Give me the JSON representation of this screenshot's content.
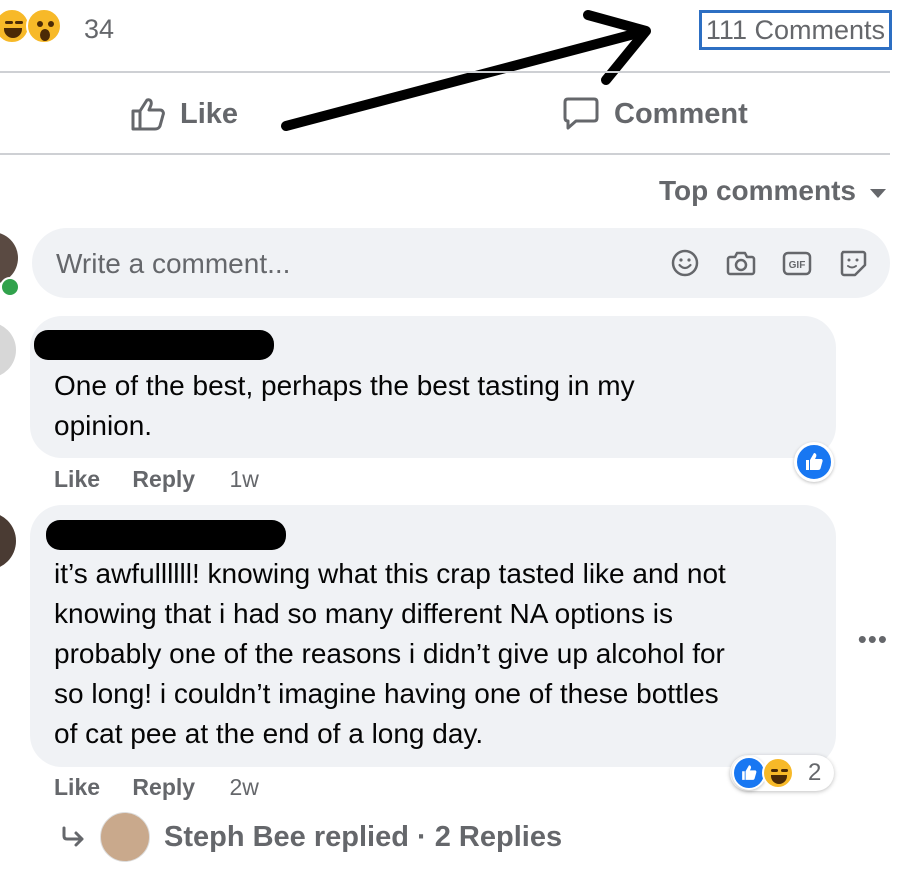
{
  "reactions": {
    "count": "34",
    "emojis": [
      "haha-icon",
      "wow-icon"
    ],
    "comment_count": "111 Comments"
  },
  "actions": {
    "like_label": "Like",
    "comment_label": "Comment"
  },
  "sort": {
    "label": "Top comments"
  },
  "composer": {
    "placeholder": "Write a comment...",
    "icons": [
      "emoji-icon",
      "camera-icon",
      "gif-icon",
      "sticker-icon"
    ]
  },
  "comments": [
    {
      "text": "One of the best, perhaps the best tasting in my opinion.",
      "line1": "One of the best, perhaps the best tasting in my",
      "line2": "opinion.",
      "like": "Like",
      "reply": "Reply",
      "time": "1w"
    },
    {
      "lines": [
        "it’s awfullllll! knowing what this crap tasted like and not",
        "knowing that i had so many different NA options is",
        "probably one of the reasons i didn’t give up alcohol for",
        "so long! i couldn’t imagine having one of these bottles",
        "of cat pee at the end of a long day."
      ],
      "like": "Like",
      "reply": "Reply",
      "time": "2w",
      "reaction_count": "2"
    }
  ],
  "replies": {
    "label": "Steph Bee replied · 2 Replies"
  },
  "colors": {
    "accent": "#1877f2",
    "muted": "#65676b",
    "bubble": "#f0f2f5",
    "highlight_box": "#2d6fc3"
  }
}
